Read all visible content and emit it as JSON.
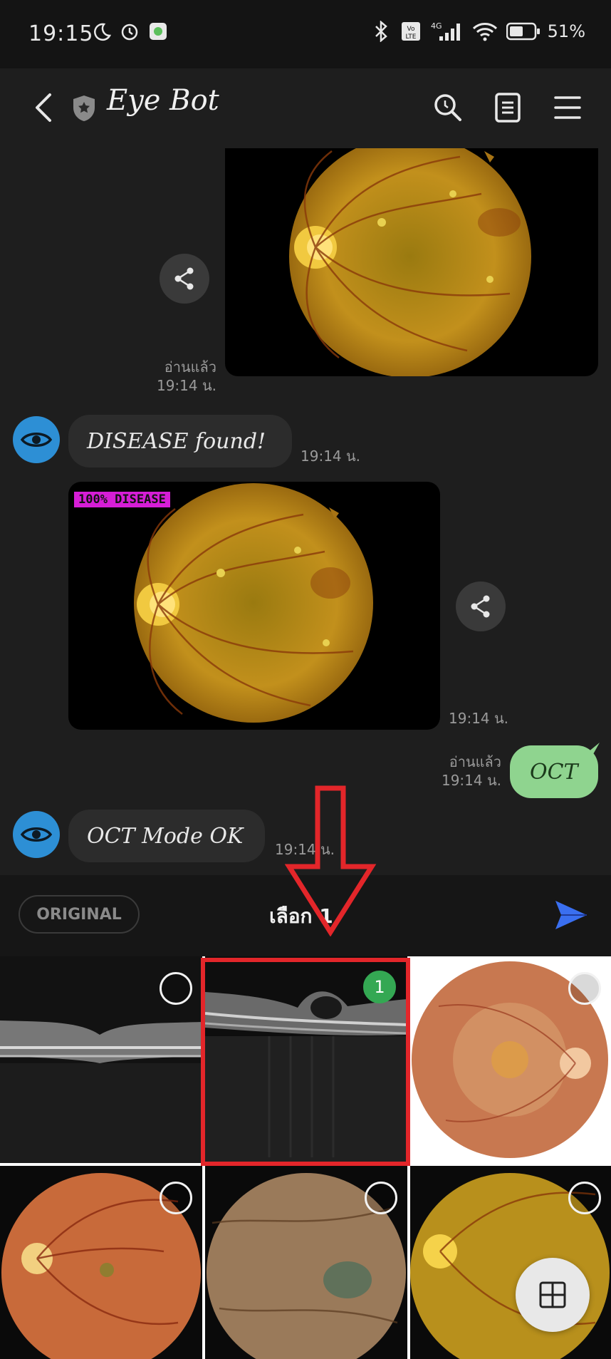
{
  "status_bar": {
    "time": "19:15",
    "battery": "51%",
    "network": "4G"
  },
  "header": {
    "title": "Eye Bot",
    "back_icon": "chevron-left-icon",
    "badge_icon": "shield-icon",
    "actions": [
      "search-icon",
      "notes-icon",
      "menu-icon"
    ]
  },
  "messages": {
    "m1": {
      "read": "อ่านแล้ว",
      "time": "19:14 น."
    },
    "m2": {
      "text": "DISEASE found!",
      "time": "19:14 น."
    },
    "m3": {
      "tag": "100% DISEASE",
      "time": "19:14 น."
    },
    "m4": {
      "text": "OCT",
      "read": "อ่านแล้ว",
      "time": "19:14 น."
    },
    "m5": {
      "text": "OCT Mode OK",
      "time": "19:14 น."
    }
  },
  "toolbar": {
    "original_label": "ORIGINAL",
    "select_title": "เลือก 1",
    "send_icon": "send-icon"
  },
  "gallery": {
    "selected_index": 1,
    "selected_badge": "1",
    "fab_icon": "grid-icon"
  },
  "colors": {
    "accent_blue": "#2d8fd5",
    "bubble_green": "#8fd48f",
    "selection_green": "#34a853",
    "annotation_red": "#e3262a",
    "disease_tag": "#d61ed6"
  }
}
